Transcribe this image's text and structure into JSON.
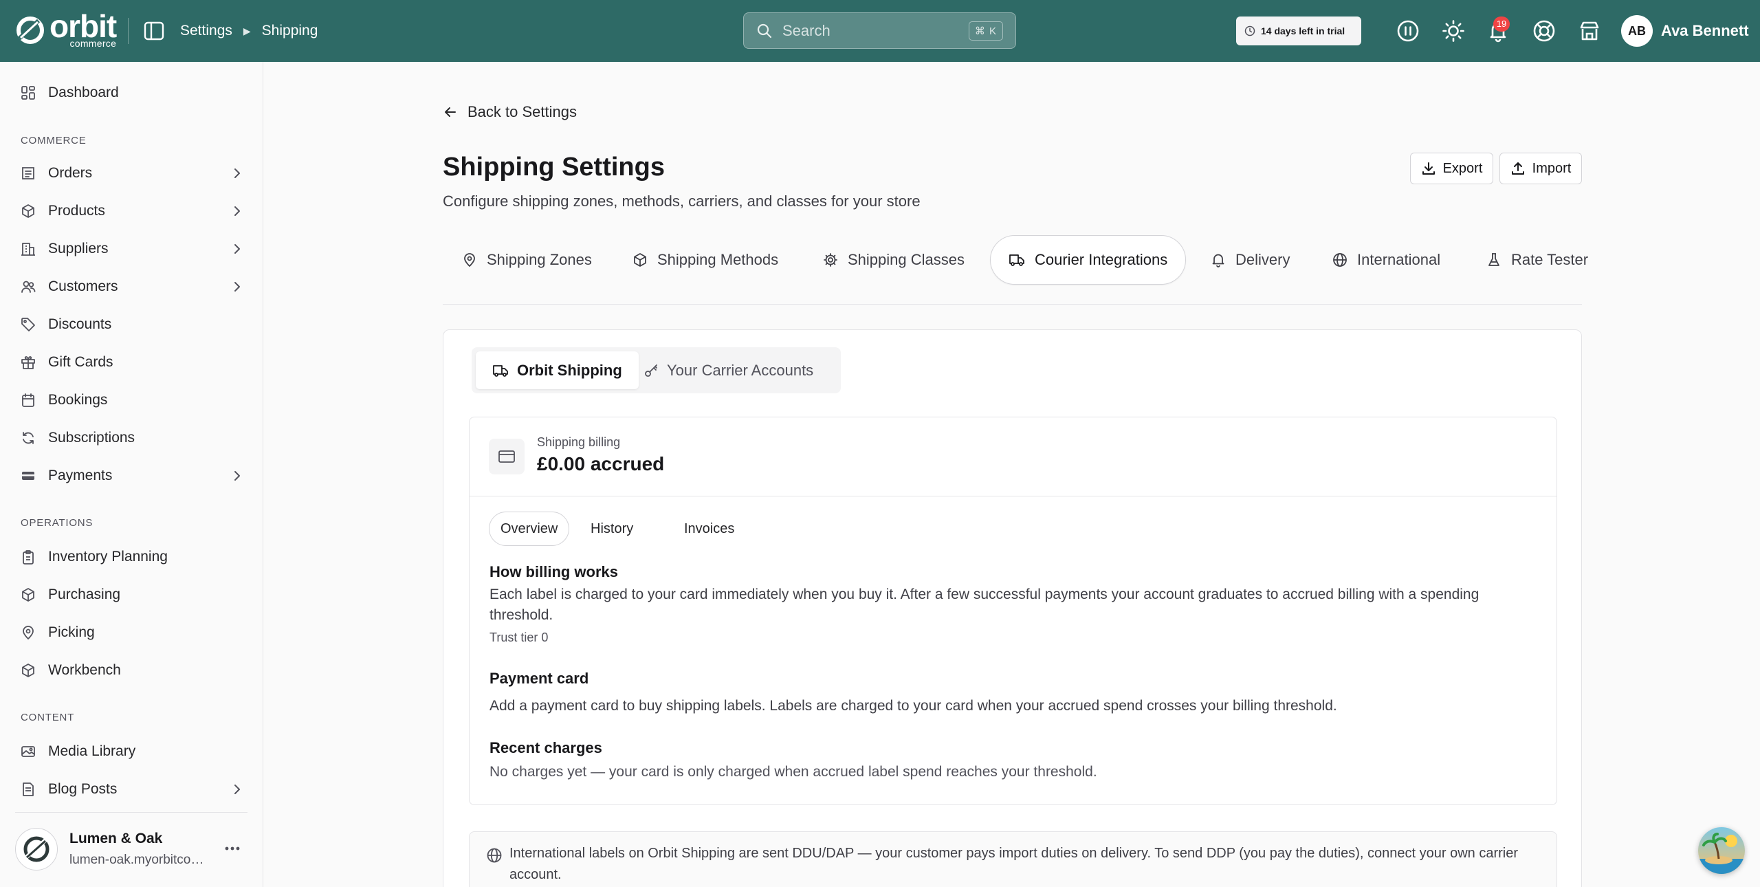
{
  "brand": {
    "name": "orbit",
    "sub": "commerce"
  },
  "breadcrumb": {
    "parent": "Settings",
    "current": "Shipping"
  },
  "search": {
    "placeholder": "Search",
    "shortcut": "⌘ K"
  },
  "trial": {
    "text": "14 days left in trial"
  },
  "notifications": {
    "count": "19"
  },
  "user": {
    "initials": "AB",
    "name": "Ava Bennett"
  },
  "sidebar": {
    "dashboard": "Dashboard",
    "sections": {
      "commerce": "COMMERCE",
      "operations": "OPERATIONS",
      "content": "CONTENT"
    },
    "commerce_items": [
      {
        "label": "Orders",
        "icon": "orders-icon",
        "has_children": true
      },
      {
        "label": "Products",
        "icon": "box-icon",
        "has_children": true
      },
      {
        "label": "Suppliers",
        "icon": "building-icon",
        "has_children": true
      },
      {
        "label": "Customers",
        "icon": "users-icon",
        "has_children": true
      },
      {
        "label": "Discounts",
        "icon": "tag-icon",
        "has_children": false
      },
      {
        "label": "Gift Cards",
        "icon": "gift-icon",
        "has_children": false
      },
      {
        "label": "Bookings",
        "icon": "calendar-icon",
        "has_children": false
      },
      {
        "label": "Subscriptions",
        "icon": "refresh-icon",
        "has_children": false
      },
      {
        "label": "Payments",
        "icon": "wallet-icon",
        "has_children": true
      }
    ],
    "operations_items": [
      {
        "label": "Inventory Planning",
        "icon": "clipboard-icon"
      },
      {
        "label": "Purchasing",
        "icon": "box-icon"
      },
      {
        "label": "Picking",
        "icon": "map-pin-icon"
      },
      {
        "label": "Workbench",
        "icon": "box-icon"
      }
    ],
    "content_items": [
      {
        "label": "Media Library",
        "icon": "image-icon",
        "has_children": false
      },
      {
        "label": "Blog Posts",
        "icon": "document-icon",
        "has_children": true
      }
    ],
    "store": {
      "name": "Lumen & Oak",
      "url": "lumen-oak.myorbitcommerce.com"
    }
  },
  "page": {
    "back_label": "Back to Settings",
    "title": "Shipping Settings",
    "subtitle": "Configure shipping zones, methods, carriers, and classes for your store",
    "export_label": "Export",
    "import_label": "Import",
    "tabs": [
      {
        "label": "Shipping Zones",
        "icon": "map-pin-icon"
      },
      {
        "label": "Shipping Methods",
        "icon": "box-icon"
      },
      {
        "label": "Shipping Classes",
        "icon": "gear-icon"
      },
      {
        "label": "Courier Integrations",
        "icon": "truck-icon",
        "active": true
      },
      {
        "label": "Delivery",
        "icon": "bell-icon"
      },
      {
        "label": "International",
        "icon": "globe-icon"
      },
      {
        "label": "Rate Tester",
        "icon": "flask-icon"
      }
    ]
  },
  "courier": {
    "segments": [
      {
        "label": "Orbit Shipping",
        "icon": "truck-icon",
        "active": true
      },
      {
        "label": "Your Carrier Accounts",
        "icon": "key-icon",
        "active": false
      }
    ],
    "billing": {
      "label": "Shipping billing",
      "amount": "£0.00 accrued",
      "subtabs": [
        "Overview",
        "History",
        "Invoices"
      ],
      "how_heading": "How billing works",
      "how_text": "Each label is charged to your card immediately when you buy it. After a few successful payments your account graduates to accrued billing with a spending threshold.",
      "trust_tier": "Trust tier 0",
      "card_heading": "Payment card",
      "card_text": "Add a payment card to buy shipping labels. Labels are charged to your card when your accrued spend crosses your billing threshold.",
      "recent_heading": "Recent charges",
      "recent_text": "No charges yet — your card is only charged when accrued label spend reaches your threshold."
    },
    "notice": "International labels on Orbit Shipping are sent DDU/DAP — your customer pays import duties on delivery. To send DDP (you pay the duties), connect your own carrier account."
  },
  "colors": {
    "topbar": "#2e6a66",
    "badge": "#ef4444",
    "background": "#fafafa"
  }
}
